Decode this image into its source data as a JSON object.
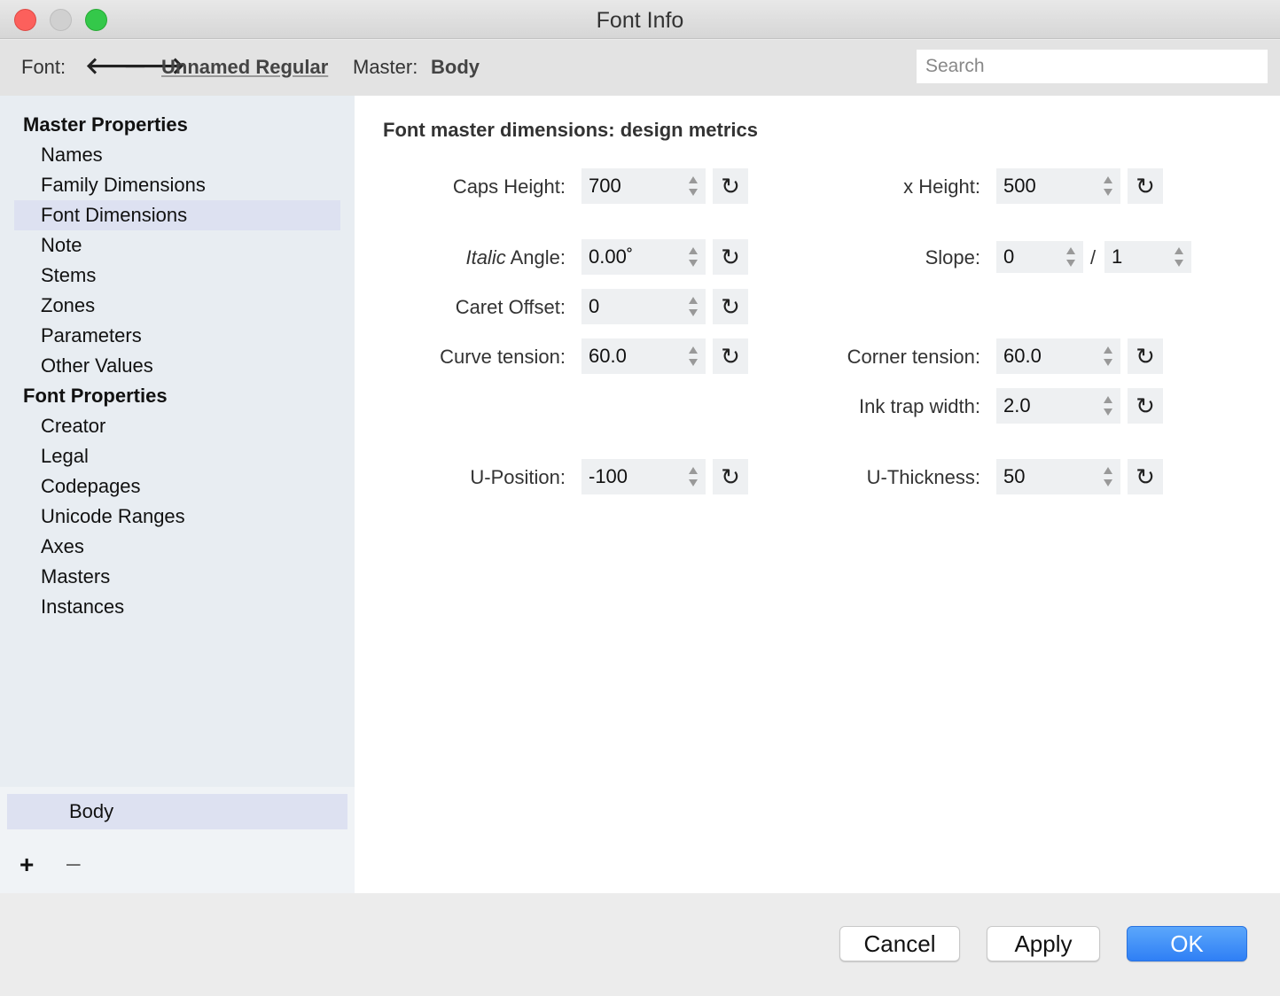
{
  "window": {
    "title": "Font Info"
  },
  "toolbar": {
    "font_label": "Font:",
    "back_arrow": "🡐",
    "forward_arrow": "🡒",
    "font_name": "Unnamed Regular",
    "master_label": "Master:",
    "master_name": "Body",
    "search_placeholder": "Search"
  },
  "sidebar": {
    "master_header": "Master Properties",
    "master_items": [
      "Names",
      "Family Dimensions",
      "Font Dimensions",
      "Note",
      "Stems",
      "Zones",
      "Parameters",
      "Other Values"
    ],
    "font_header": "Font Properties",
    "font_items": [
      "Creator",
      "Legal",
      "Codepages",
      "Unicode Ranges",
      "Axes",
      "Masters",
      "Instances"
    ],
    "selected": "Font Dimensions",
    "masters_list": [
      "Body"
    ],
    "add_label": "+",
    "remove_label": "–"
  },
  "content": {
    "title": "Font master dimensions: design metrics",
    "caps_height": {
      "label": "Caps Height:",
      "value": "700"
    },
    "x_height": {
      "label": "x Height:",
      "value": "500"
    },
    "italic_angle": {
      "label_italic": "Italic",
      "label_rest": " Angle:",
      "value": "0.00˚"
    },
    "slope": {
      "label": "Slope:",
      "numerator": "0",
      "separator": "/",
      "denominator": "1"
    },
    "caret_offset": {
      "label": "Caret Offset:",
      "value": "0"
    },
    "curve_tension": {
      "label": "Curve tension:",
      "value": "60.0"
    },
    "corner_tension": {
      "label": "Corner tension:",
      "value": "60.0"
    },
    "ink_trap_width": {
      "label": "Ink trap width:",
      "value": "2.0"
    },
    "u_position": {
      "label": "U-Position:",
      "value": "-100"
    },
    "u_thickness": {
      "label": "U-Thickness:",
      "value": "50"
    },
    "reset_glyph": "↻"
  },
  "footer": {
    "cancel": "Cancel",
    "apply": "Apply",
    "ok": "OK"
  },
  "colors": {
    "accent": "#2f7ff5",
    "selection": "#dde1f1",
    "sidebar_bg": "#e8edf2"
  }
}
